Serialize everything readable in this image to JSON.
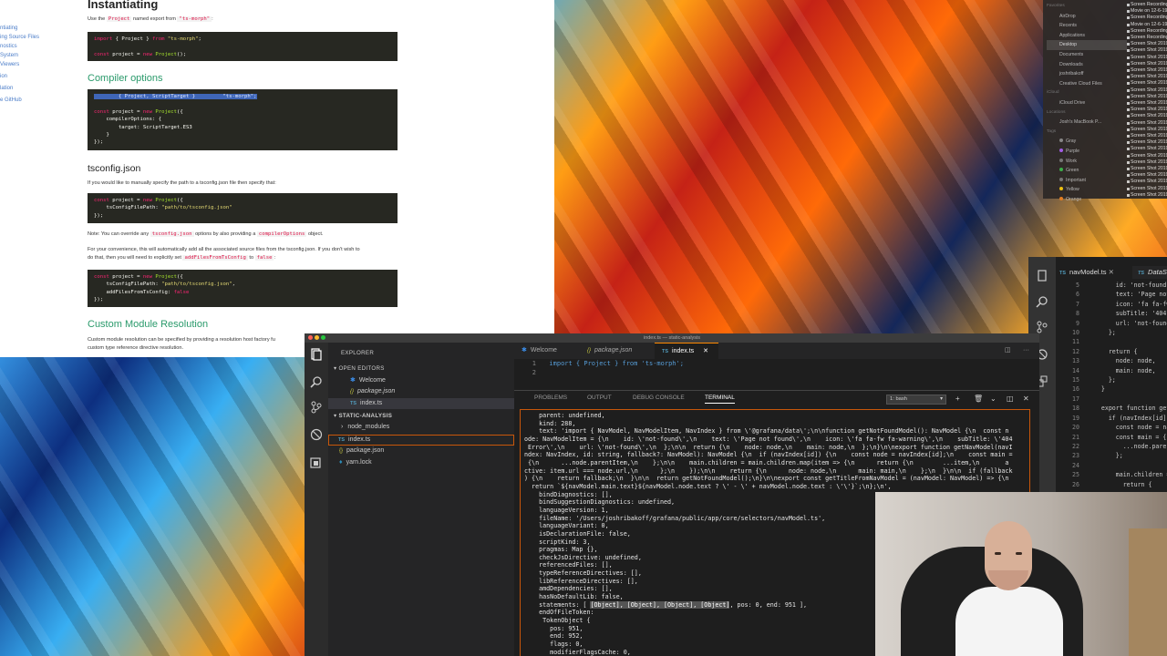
{
  "docs": {
    "nav": [
      "ntiating",
      "ing Source Files",
      "nostics",
      "System",
      "Viewers",
      "ion",
      "lation",
      "",
      "e GitHub"
    ],
    "title": "Instantiating",
    "intro": {
      "pre": "Use the ",
      "code1": "Project",
      "mid": " named export from ",
      "code2": "\"ts-morph\"",
      "post": ":"
    },
    "code1": [
      "import { Project } from \"ts-morph\";",
      "",
      "const project = new Project();"
    ],
    "compiler_heading": "Compiler options",
    "code2": [
      "        { Project, ScriptTarget }         \"ts-morph\";",
      "",
      "const project = new Project({",
      "    compilerOptions: {",
      "        target: ScriptTarget.ES3",
      "    }",
      "});"
    ],
    "tsconfig_heading": "tsconfig.json",
    "tsconfig_p": "If you would like to manually specify the path to a tsconfig.json file then specify that:",
    "code3": [
      "const project = new Project({",
      "    tsConfigFilePath: \"path/to/tsconfig.json\"",
      "});"
    ],
    "note": {
      "pre": "Note: You can override any ",
      "code1": "tsconfig.json",
      "mid": " options by also providing a ",
      "code2": "compilerOptions",
      "post": " object."
    },
    "conv_p1": "For your convenience, this will automatically add all the associated source files from the tsconfig.json. If you don't wish to",
    "conv_p2": {
      "pre": "do that, then you will need to explicitly set ",
      "code1": "addFilesFromTsConfig",
      "mid": " to ",
      "code2": "false",
      "post": ":"
    },
    "code4": [
      "const project = new Project({",
      "    tsConfigFilePath: \"path/to/tsconfig.json\",",
      "    addFilesFromTsConfig: false",
      "});"
    ],
    "custom_heading": "Custom Module Resolution",
    "custom_p1": "Custom module resolution can be specified by providing a resolution host factory fu",
    "custom_p2": "custom type reference directive resolution."
  },
  "finder": {
    "sidebar": [
      {
        "type": "sec",
        "label": "Favorites"
      },
      {
        "type": "it",
        "label": "AirDrop"
      },
      {
        "type": "it",
        "label": "Recents"
      },
      {
        "type": "it",
        "label": "Applications"
      },
      {
        "type": "it sel",
        "label": "Desktop"
      },
      {
        "type": "it",
        "label": "Documents"
      },
      {
        "type": "it",
        "label": "Downloads"
      },
      {
        "type": "it",
        "label": "joshribakoff"
      },
      {
        "type": "it",
        "label": "Creative Cloud Files"
      },
      {
        "type": "sec",
        "label": "iCloud"
      },
      {
        "type": "it",
        "label": "iCloud Drive"
      },
      {
        "type": "sec",
        "label": "Locations"
      },
      {
        "type": "it",
        "label": "Josh's MacBook P..."
      },
      {
        "type": "sec",
        "label": "Tags"
      },
      {
        "type": "it",
        "label": "Gray"
      },
      {
        "type": "it",
        "label": "Purple"
      },
      {
        "type": "it",
        "label": "Work"
      },
      {
        "type": "it",
        "label": "Green"
      },
      {
        "type": "it",
        "label": "Important"
      },
      {
        "type": "it",
        "label": "Yellow"
      },
      {
        "type": "it",
        "label": "Orange"
      }
    ],
    "files": [
      "Screen Recording",
      "Movie on 12-6-19",
      "Screen Recording",
      "Movie on 12-6-19",
      "Screen Recording",
      "Screen Recording",
      "Screen Shot 2019",
      "Screen Shot 2019",
      "Screen Shot 2019",
      "Screen Shot 2019",
      "Screen Shot 2019",
      "Screen Shot 2019",
      "Screen Shot 2019",
      "Screen Shot 2019",
      "Screen Shot 2019",
      "Screen Shot 2019",
      "Screen Shot 2019",
      "Screen Shot 2019",
      "Screen Shot 2019",
      "Screen Shot 2019",
      "Screen Shot 2019",
      "Screen Shot 2019",
      "Screen Shot 2019",
      "Screen Shot 2019",
      "Screen Shot 2019",
      "Screen Shot 2019",
      "Screen Shot 2019",
      "Screen Shot 2019",
      "Screen Shot 2019",
      "Screen Shot 2019"
    ]
  },
  "rcode": {
    "tab1": "navModel.ts",
    "tab2": "DataSo",
    "lines": [
      {
        "n": "5",
        "t": "        id: 'not-found',"
      },
      {
        "n": "6",
        "t": "        text: 'Page not"
      },
      {
        "n": "7",
        "t": "        icon: 'fa fa-fw"
      },
      {
        "n": "8",
        "t": "        subTitle: '404"
      },
      {
        "n": "9",
        "t": "        url: 'not-found'"
      },
      {
        "n": "10",
        "t": "      };"
      },
      {
        "n": "11",
        "t": ""
      },
      {
        "n": "12",
        "t": "      return {"
      },
      {
        "n": "13",
        "t": "        node: node,"
      },
      {
        "n": "14",
        "t": "        main: node,"
      },
      {
        "n": "15",
        "t": "      };"
      },
      {
        "n": "16",
        "t": "    }"
      },
      {
        "n": "17",
        "t": ""
      },
      {
        "n": "18",
        "t": "    export function get"
      },
      {
        "n": "19",
        "t": "      if (navIndex[id])"
      },
      {
        "n": "20",
        "t": "        const node = nav"
      },
      {
        "n": "21",
        "t": "        const main = {"
      },
      {
        "n": "22",
        "t": "          ...node.parent"
      },
      {
        "n": "23",
        "t": "        };"
      },
      {
        "n": "24",
        "t": ""
      },
      {
        "n": "25",
        "t": "        main.children ="
      },
      {
        "n": "26",
        "t": "          return {"
      }
    ]
  },
  "vscode": {
    "window_title": "index.ts — static-analysis",
    "explorer_title": "EXPLORER",
    "open_editors": "OPEN EDITORS",
    "open_files": [
      "Welcome",
      "package.json",
      "index.ts"
    ],
    "project": "STATIC-ANALYSIS",
    "tree": [
      "node_modules",
      "index.ts",
      "package.json",
      "yarn.lock"
    ],
    "tabs": [
      "Welcome",
      "package.json",
      "index.ts"
    ],
    "code": [
      {
        "n": "1",
        "t": "  import { Project } from 'ts-morph';"
      },
      {
        "n": "2",
        "t": ""
      }
    ],
    "panel_tabs": [
      "PROBLEMS",
      "OUTPUT",
      "DEBUG CONSOLE",
      "TERMINAL"
    ],
    "terminal_select": "1: bash",
    "terminal_lines": [
      "    parent: undefined,",
      "    kind: 288,",
      "    text: 'import { NavModel, NavModelItem, NavIndex } from \\'@grafana/data\\';\\n\\nfunction getNotFoundModel(): NavModel {\\n  const n",
      "ode: NavModelItem = {\\n    id: \\'not-found\\',\\n    text: \\'Page not found\\',\\n    icon: \\'fa fa-fw fa-warning\\',\\n    subTitle: \\'404",
      " Error\\',\\n    url: \\'not-found\\',\\n  };\\n\\n  return {\\n    node: node,\\n    main: node,\\n  };\\n}\\n\\nexport function getNavModel(navI",
      "ndex: NavIndex, id: string, fallback?: NavModel): NavModel {\\n  if (navIndex[id]) {\\n    const node = navIndex[id];\\n    const main = ",
      " {\\n      ...node.parentItem,\\n    };\\n\\n    main.children = main.children.map(item => {\\n      return {\\n        ...item,\\n       a",
      "ctive: item.url === node.url,\\n      };\\n    });\\n\\n    return {\\n      node: node,\\n      main: main,\\n    };\\n  }\\n\\n  if (fallback",
      ") {\\n    return fallback;\\n  }\\n\\n  return getNotFoundModel();\\n}\\n\\nexport const getTitleFromNavModel = (navModel: NavModel) => {\\n",
      "  return `${navModel.main.text}${navModel.node.text ? \\' - \\' + navModel.node.text : \\'\\'}`;\\n};\\n',",
      "    bindDiagnostics: [],",
      "    bindSuggestionDiagnostics: undefined,",
      "    languageVersion: 1,",
      "    fileName: '/Users/joshribakoff/grafana/public/app/core/selectors/navModel.ts',",
      "    languageVariant: 0,",
      "    isDeclarationFile: false,",
      "    scriptKind: 3,",
      "    pragmas: Map {},",
      "    checkJsDirective: undefined,",
      "    referencedFiles: [],",
      "    typeReferenceDirectives: [],",
      "    libReferenceDirectives: [],",
      "    amdDependencies: [],",
      "    hasNoDefaultLib: false,",
      "    statements: [ [Object], [Object], [Object], [Object], pos: 0, end: 951 ],",
      "    endOfFileToken:",
      "     TokenObject {",
      "       pos: 951,",
      "       end: 952,",
      "       flags: 0,",
      "       modifierFlagsCache: 0,",
      "       transformFlags: 0,",
      "       parent: [Circular],"
    ]
  }
}
